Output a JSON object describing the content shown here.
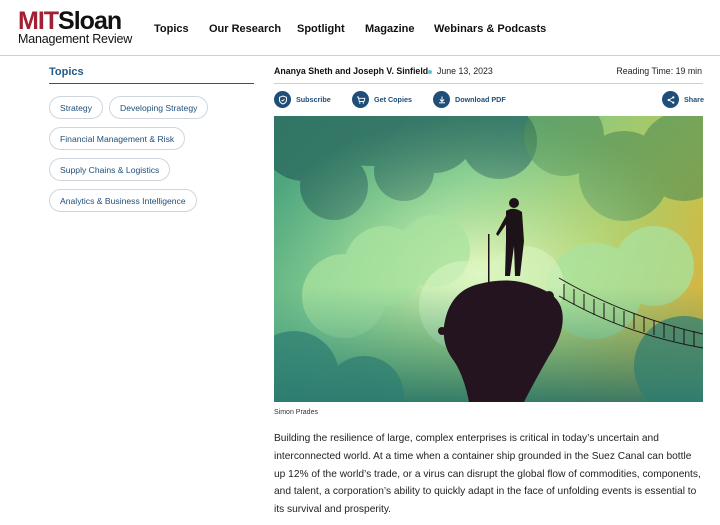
{
  "header": {
    "logo_mit": "MIT",
    "logo_sloan": "Sloan",
    "logo_sub": "Management Review",
    "nav": [
      "Topics",
      "Our Research",
      "Spotlight",
      "Magazine",
      "Webinars & Podcasts"
    ]
  },
  "sidebar": {
    "title": "Topics",
    "pills": [
      "Strategy",
      "Developing Strategy",
      "Financial Management & Risk",
      "Supply Chains & Logistics",
      "Analytics & Business Intelligence"
    ]
  },
  "article": {
    "authors": "Ananya Sheth and Joseph V. Sinfield",
    "date": "June 13, 2023",
    "reading_time": "Reading Time: 19 min",
    "actions": {
      "subscribe": "Subscribe",
      "get_copies": "Get Copies",
      "download_pdf": "Download PDF",
      "share": "Share"
    },
    "image_caption": "Simon Prades",
    "paragraph": "Building the resilience of large, complex enterprises is critical in today’s uncertain and interconnected world. At a time when a container ship grounded in the Suez Canal can bottle up 12% of the world’s trade, or a virus can disrupt the global flow of commodities, components, and talent, a corporation’s ability to quickly adapt in the face of unfolding events is essential to its survival and prosperity."
  },
  "colors": {
    "brand_red": "#a31f34",
    "link_blue": "#1f4e79"
  },
  "icons": {
    "subscribe": "shield-icon",
    "get_copies": "cart-icon",
    "download_pdf": "download-icon",
    "share": "share-icon"
  }
}
